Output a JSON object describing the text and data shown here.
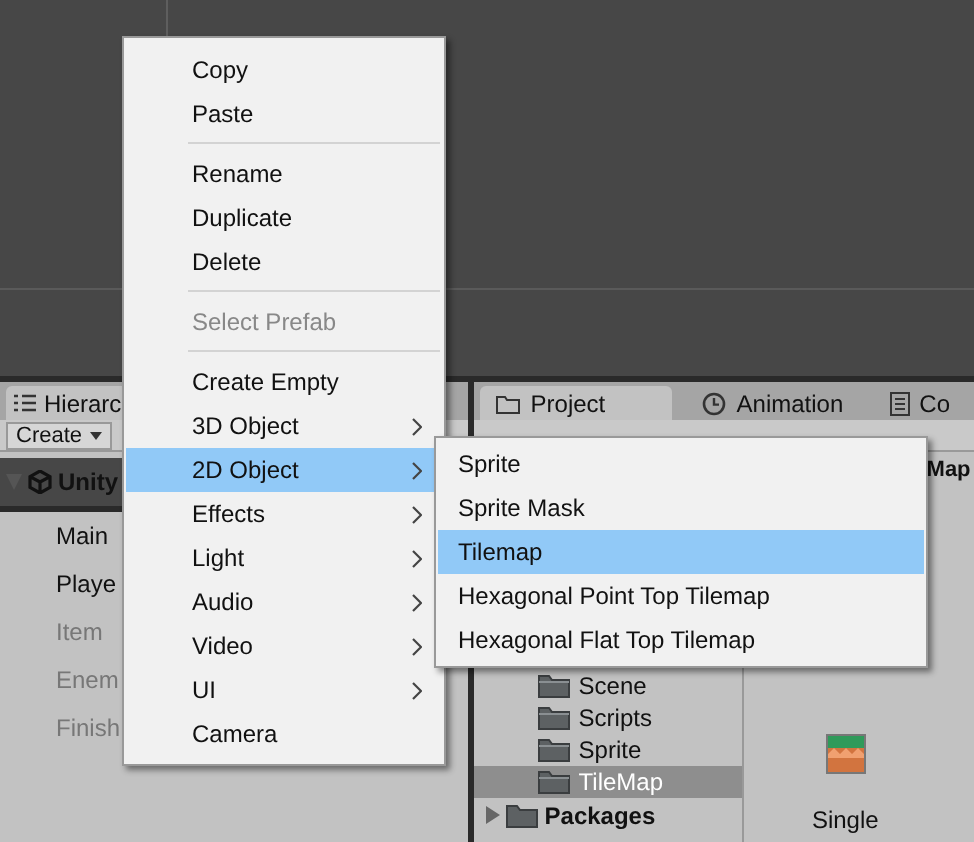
{
  "hierarchy": {
    "tab": "Hierarc",
    "create_button": "Create",
    "rows": [
      {
        "label": "Unity",
        "kind": "scene"
      },
      {
        "label": "Main",
        "kind": "object",
        "disabled": false
      },
      {
        "label": "Playe",
        "kind": "object",
        "disabled": false
      },
      {
        "label": "Item",
        "kind": "object",
        "disabled": true
      },
      {
        "label": "Enem",
        "kind": "object",
        "disabled": true
      },
      {
        "label": "Finish",
        "kind": "object",
        "disabled": true
      }
    ]
  },
  "project": {
    "tabs": [
      {
        "label": "Project",
        "kind": "folder",
        "selected": true
      },
      {
        "label": "Animation",
        "kind": "clock",
        "selected": false
      },
      {
        "label": "Co",
        "kind": "doc",
        "selected": false
      }
    ],
    "breadcrumb": "Map",
    "folders": [
      {
        "label": "Scene",
        "selected": false
      },
      {
        "label": "Scripts",
        "selected": false
      },
      {
        "label": "Sprite",
        "selected": false
      },
      {
        "label": "TileMap",
        "selected": true
      }
    ],
    "packages": "Packages",
    "asset": {
      "label": "Single"
    }
  },
  "context_menu": {
    "items": [
      {
        "kind": "item",
        "label": "Copy",
        "disabled": false,
        "selected": false,
        "submenu": false
      },
      {
        "kind": "item",
        "label": "Paste",
        "disabled": false,
        "selected": false,
        "submenu": false
      },
      {
        "kind": "separator"
      },
      {
        "kind": "item",
        "label": "Rename",
        "disabled": false,
        "selected": false,
        "submenu": false
      },
      {
        "kind": "item",
        "label": "Duplicate",
        "disabled": false,
        "selected": false,
        "submenu": false
      },
      {
        "kind": "item",
        "label": "Delete",
        "disabled": false,
        "selected": false,
        "submenu": false
      },
      {
        "kind": "separator"
      },
      {
        "kind": "item",
        "label": "Select Prefab",
        "disabled": true,
        "selected": false,
        "submenu": false
      },
      {
        "kind": "separator"
      },
      {
        "kind": "item",
        "label": "Create Empty",
        "disabled": false,
        "selected": false,
        "submenu": false
      },
      {
        "kind": "item",
        "label": "3D Object",
        "disabled": false,
        "selected": false,
        "submenu": true
      },
      {
        "kind": "item",
        "label": "2D Object",
        "disabled": false,
        "selected": true,
        "submenu": true
      },
      {
        "kind": "item",
        "label": "Effects",
        "disabled": false,
        "selected": false,
        "submenu": true
      },
      {
        "kind": "item",
        "label": "Light",
        "disabled": false,
        "selected": false,
        "submenu": true
      },
      {
        "kind": "item",
        "label": "Audio",
        "disabled": false,
        "selected": false,
        "submenu": true
      },
      {
        "kind": "item",
        "label": "Video",
        "disabled": false,
        "selected": false,
        "submenu": true
      },
      {
        "kind": "item",
        "label": "UI",
        "disabled": false,
        "selected": false,
        "submenu": true
      },
      {
        "kind": "item",
        "label": "Camera",
        "disabled": false,
        "selected": false,
        "submenu": false
      }
    ]
  },
  "submenu": {
    "items": [
      {
        "label": "Sprite",
        "selected": false
      },
      {
        "label": "Sprite Mask",
        "selected": false
      },
      {
        "label": "Tilemap",
        "selected": true
      },
      {
        "label": "Hexagonal Point Top Tilemap",
        "selected": false
      },
      {
        "label": "Hexagonal Flat Top Tilemap",
        "selected": false
      }
    ]
  }
}
